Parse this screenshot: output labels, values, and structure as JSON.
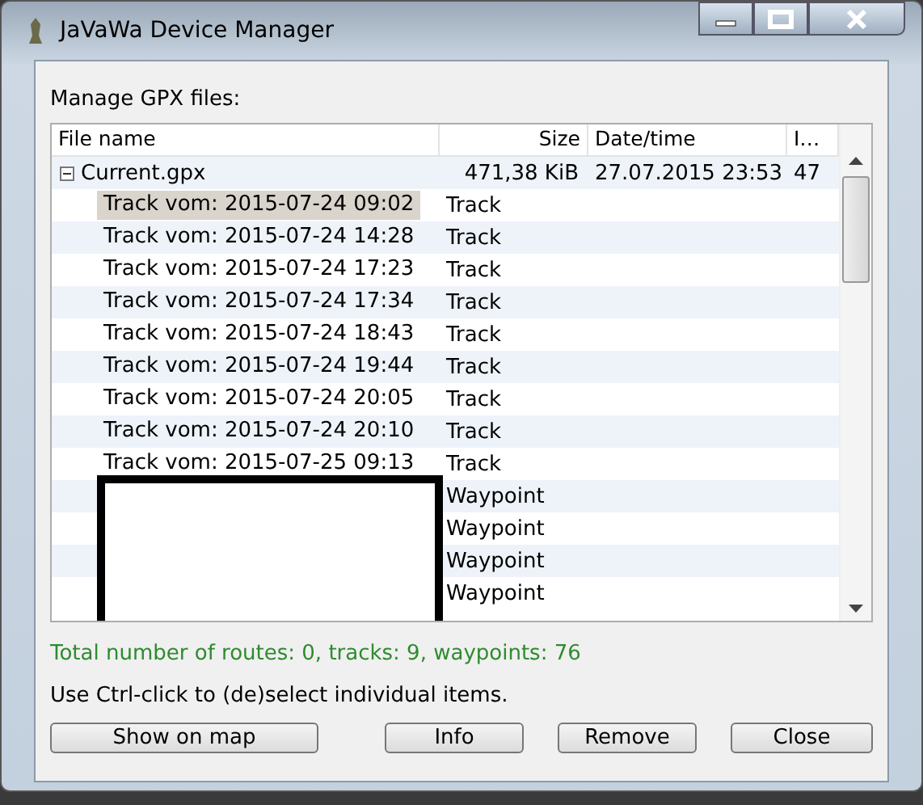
{
  "window": {
    "title": "JaVaWa Device Manager"
  },
  "label": "Manage GPX files:",
  "table": {
    "columns": [
      "File name",
      "Size",
      "Date/time",
      "I…"
    ],
    "root": {
      "name": "Current.gpx",
      "size": "471,38 KiB",
      "date": "27.07.2015 23:53",
      "column_4": "47",
      "expanded": true,
      "children": [
        {
          "kind": "track",
          "name": "Track vom: 2015-07-24 09:02",
          "type": "Track",
          "selected": true
        },
        {
          "kind": "track",
          "name": "Track vom: 2015-07-24 14:28",
          "type": "Track",
          "selected": false
        },
        {
          "kind": "track",
          "name": "Track vom: 2015-07-24 17:23",
          "type": "Track",
          "selected": false
        },
        {
          "kind": "track",
          "name": "Track vom: 2015-07-24 17:34",
          "type": "Track",
          "selected": false
        },
        {
          "kind": "track",
          "name": "Track vom: 2015-07-24 18:43",
          "type": "Track",
          "selected": false
        },
        {
          "kind": "track",
          "name": "Track vom: 2015-07-24 19:44",
          "type": "Track",
          "selected": false
        },
        {
          "kind": "track",
          "name": "Track vom: 2015-07-24 20:05",
          "type": "Track",
          "selected": false
        },
        {
          "kind": "track",
          "name": "Track vom: 2015-07-24 20:10",
          "type": "Track",
          "selected": false
        },
        {
          "kind": "track",
          "name": "Track vom: 2015-07-25 09:13",
          "type": "Track",
          "selected": false
        },
        {
          "kind": "redacted",
          "type": "Waypoint",
          "selected": false
        },
        {
          "kind": "redacted",
          "type": "Waypoint",
          "selected": false
        },
        {
          "kind": "redacted",
          "type": "Waypoint",
          "selected": false
        },
        {
          "kind": "redacted",
          "type": "Waypoint",
          "selected": false
        }
      ]
    }
  },
  "status": "Total number of routes: 0, tracks: 9, waypoints: 76",
  "hint": "Use Ctrl-click to (de)select individual items.",
  "buttons": [
    "Show on map",
    "Info",
    "Remove",
    "Close"
  ]
}
